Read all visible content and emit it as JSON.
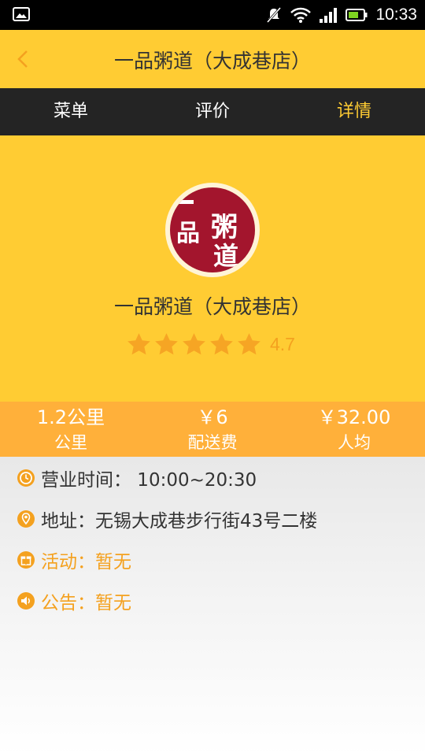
{
  "status_bar": {
    "time": "10:33",
    "icons": [
      "image-icon",
      "notification-muted-icon",
      "wifi-icon",
      "signal-icon",
      "battery-icon"
    ]
  },
  "header": {
    "back_icon": "chevron-left-icon",
    "title": "一品粥道（大成巷店）"
  },
  "tabs": [
    {
      "label": "菜单",
      "active": false
    },
    {
      "label": "评价",
      "active": false
    },
    {
      "label": "详情",
      "active": true
    }
  ],
  "shop": {
    "logo_text": [
      "一",
      "品",
      "粥",
      "道"
    ],
    "name": "一品粥道（大成巷店）",
    "rating": "4.7",
    "stars_filled": 5
  },
  "stats": [
    {
      "value": "1.2公里",
      "label": "公里"
    },
    {
      "value": "￥6",
      "label": "配送费"
    },
    {
      "value": "￥32.00",
      "label": "人均"
    }
  ],
  "info": {
    "hours": {
      "icon": "clock-icon",
      "text": "营业时间： 10:00~20:30"
    },
    "address": {
      "icon": "location-pin-icon",
      "text": "地址：无锡大成巷步行街43号二楼"
    },
    "activity": {
      "icon": "gift-icon",
      "text": "活动：暂无"
    },
    "notice": {
      "icon": "speaker-icon",
      "text": "公告：暂无"
    }
  },
  "colors": {
    "brand_yellow": "#ffcc33",
    "tab_bar_bg": "#242424",
    "stats_orange": "#ffb03a",
    "accent_orange": "#f4a11f",
    "logo_red": "#a3152d"
  }
}
